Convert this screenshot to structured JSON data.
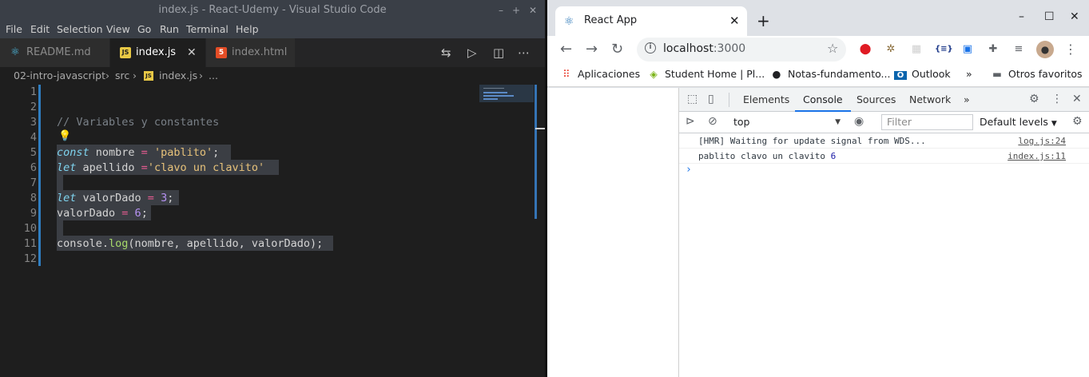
{
  "vscode": {
    "title": "index.js - React-Udemy - Visual Studio Code",
    "window_controls": {
      "minimize": "–",
      "maximize": "+",
      "close": "✕"
    },
    "menu": [
      "File",
      "Edit",
      "Selection",
      "View",
      "Go",
      "Run",
      "Terminal",
      "Help"
    ],
    "tabs": [
      {
        "label": "README.md",
        "icon": "react-icon",
        "active": false
      },
      {
        "label": "index.js",
        "icon": "js-icon",
        "active": true,
        "close": "✕"
      },
      {
        "label": "index.html",
        "icon": "html5-icon",
        "active": false
      }
    ],
    "breadcrumb": [
      "02-intro-javascript",
      "src",
      "index.js",
      "..."
    ],
    "line_numbers": [
      "1",
      "2",
      "3",
      "4",
      "5",
      "6",
      "7",
      "8",
      "9",
      "10",
      "11",
      "12"
    ],
    "code": {
      "l3": "// Variables y constantes",
      "l5": {
        "kw": "const",
        "name": " nombre ",
        "op": "=",
        "str": " 'pablito'",
        "end": ";"
      },
      "l6": {
        "kw": "let",
        "name": " apellido ",
        "op": "=",
        "str": "'clavo un clavito'"
      },
      "l8": {
        "kw": "let",
        "name": " valorDado ",
        "op": "=",
        "num": " 3",
        "end": ";"
      },
      "l9": {
        "name": "valorDado ",
        "op": "=",
        "num": " 6",
        "end": ";"
      },
      "l11": {
        "obj": "console.",
        "fn": "log",
        "args": "(nombre, apellido, valorDado);"
      }
    },
    "colors": {
      "accent": "#2f7dc0",
      "keyword": "#7fd4ef",
      "string": "#e7c27a",
      "operator": "#e95c92",
      "number": "#b692f3"
    }
  },
  "chrome": {
    "tab_title": "React App",
    "tab_icon": "react-icon",
    "url_host": "localhost",
    "url_port": ":3000",
    "window_controls": {
      "minimize": "–",
      "maximize": "☐",
      "close": "✕"
    },
    "bookmarks": [
      {
        "label": "Aplicaciones",
        "icon": "apps-grid-icon"
      },
      {
        "label": "Student Home | Pl...",
        "icon": "pluralsight-icon"
      },
      {
        "label": "Notas-fundamento...",
        "icon": "github-icon"
      },
      {
        "label": "Outlook",
        "icon": "outlook-icon"
      }
    ],
    "bookmarks_overflow": "»",
    "other_bookmarks": "Otros favoritos",
    "devtools": {
      "tabs": [
        "Elements",
        "Console",
        "Sources",
        "Network"
      ],
      "active_tab": "Console",
      "more_tabs": "»",
      "context": "top",
      "filter_placeholder": "Filter",
      "levels": "Default levels",
      "console": [
        {
          "message": "[HMR] Waiting for update signal from WDS...",
          "source": "log.js:24"
        },
        {
          "message": "pablito clavo un clavito ",
          "value": "6",
          "source": "index.js:11"
        }
      ],
      "prompt": "›"
    }
  }
}
